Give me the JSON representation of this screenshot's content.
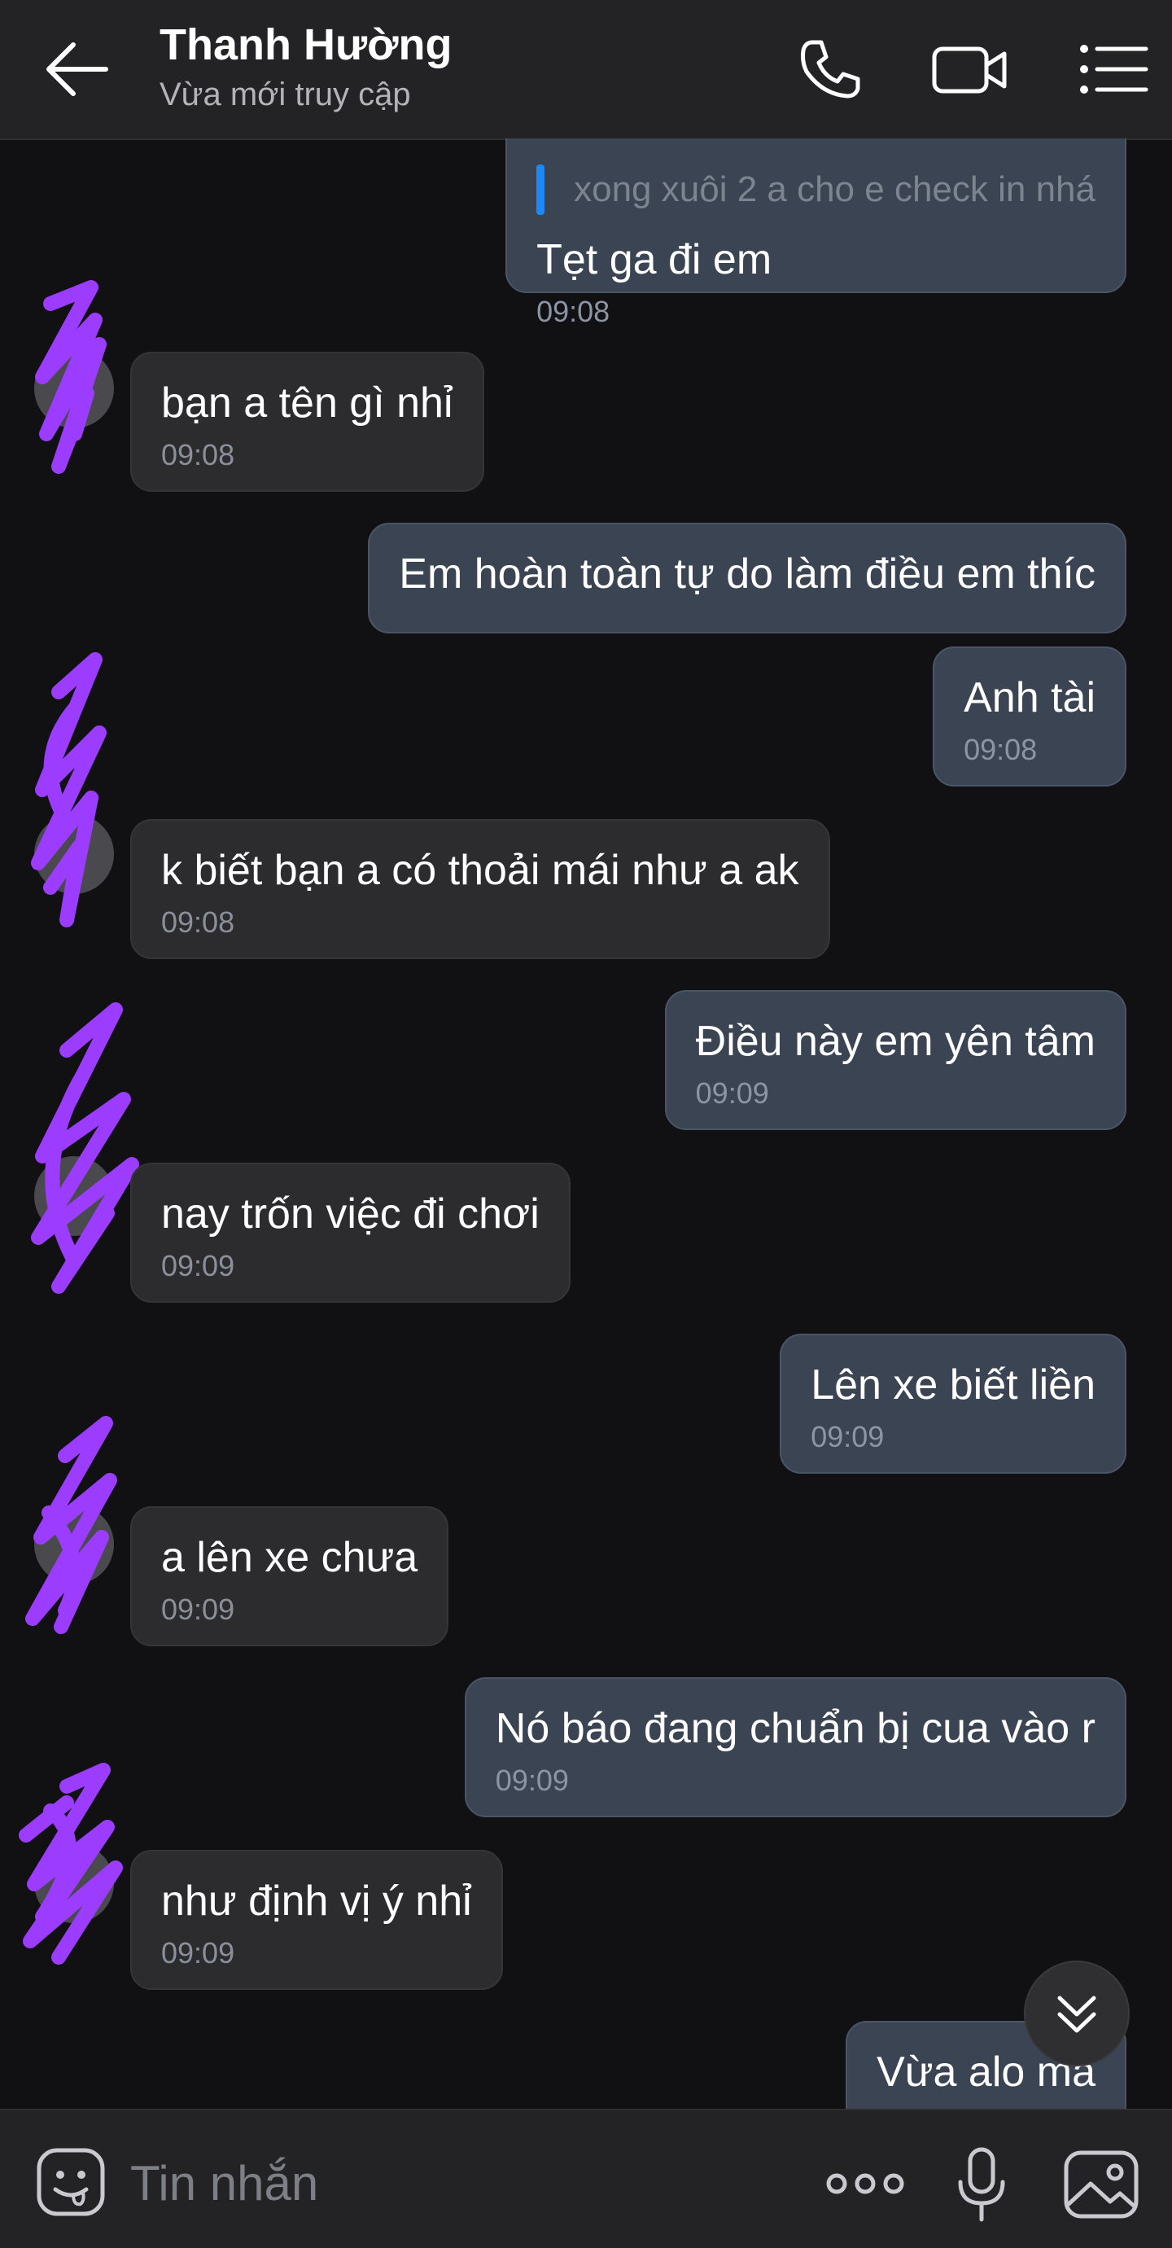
{
  "header": {
    "title": "Thanh Hường",
    "subtitle": "Vừa mới truy cập",
    "icons": [
      "back-arrow-icon",
      "phone-icon",
      "video-camera-icon",
      "menu-list-icon"
    ]
  },
  "messages": [
    {
      "dir": "out",
      "quote": "xong xuôi 2 a cho e check in nhá",
      "text": "Tẹt ga đi em",
      "time": "09:08"
    },
    {
      "dir": "in",
      "text": "bạn a tên gì nhỉ",
      "time": "09:08"
    },
    {
      "dir": "out",
      "text": "Em hoàn toàn tự do làm điều em thíc",
      "time": ""
    },
    {
      "dir": "out",
      "text": "Anh tài",
      "time": "09:08"
    },
    {
      "dir": "in",
      "text": "k biết bạn a có thoải mái như a ak",
      "time": "09:08"
    },
    {
      "dir": "out",
      "text": "Điều này em yên tâm",
      "time": "09:09"
    },
    {
      "dir": "in",
      "text": "nay trốn việc đi chơi",
      "time": "09:09"
    },
    {
      "dir": "out",
      "text": "Lên xe biết liền",
      "time": "09:09"
    },
    {
      "dir": "in",
      "text": "a lên xe chưa",
      "time": "09:09"
    },
    {
      "dir": "out",
      "text": "Nó báo đang chuẩn bị cua vào r",
      "time": "09:09"
    },
    {
      "dir": "in",
      "text": "như định vị ý nhỉ",
      "time": "09:09"
    },
    {
      "dir": "out",
      "text": "Vừa alo mà",
      "time": ""
    }
  ],
  "composer": {
    "placeholder": "Tin nhắn",
    "icons": [
      "emoji-icon",
      "more-options-icon",
      "microphone-icon",
      "image-icon"
    ]
  },
  "colors": {
    "background": "#111113",
    "bar": "#232325",
    "incoming_bubble": "#2c2c2e",
    "outgoing_bubble": "#3a4452",
    "quote_bar": "#1e88f5",
    "scribble": "#9b3cff"
  }
}
